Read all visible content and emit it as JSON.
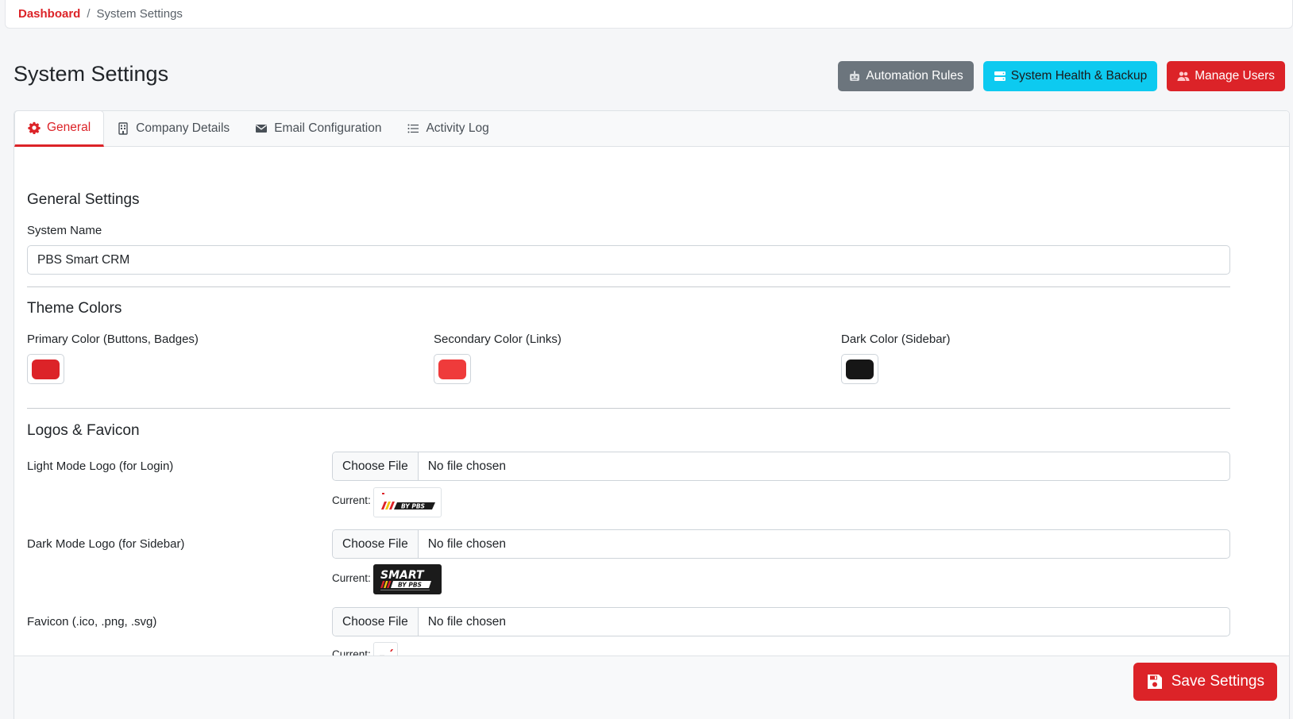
{
  "breadcrumb": {
    "home": "Dashboard",
    "separator": "/",
    "current": "System Settings"
  },
  "page": {
    "title": "System Settings"
  },
  "actions": {
    "automation": "Automation Rules",
    "health": "System Health & Backup",
    "users": "Manage Users"
  },
  "tabs": [
    {
      "label": "General",
      "icon": "gear-icon"
    },
    {
      "label": "Company Details",
      "icon": "building-icon"
    },
    {
      "label": "Email Configuration",
      "icon": "envelope-icon"
    },
    {
      "label": "Activity Log",
      "icon": "list-icon"
    }
  ],
  "general": {
    "section_title": "General Settings",
    "system_name_label": "System Name",
    "system_name_value": "PBS Smart CRM"
  },
  "theme": {
    "section_title": "Theme Colors",
    "primary_label": "Primary Color (Buttons, Badges)",
    "primary_color": "#dc2328",
    "secondary_label": "Secondary Color (Links)",
    "secondary_color": "#ef3b3b",
    "dark_label": "Dark Color (Sidebar)",
    "dark_color": "#161616"
  },
  "logos": {
    "section_title": "Logos & Favicon",
    "choose_file": "Choose File",
    "no_file": "No file chosen",
    "current_label": "Current:",
    "light_label": "Light Mode Logo (for Login)",
    "dark_label": "Dark Mode Logo (for Sidebar)",
    "favicon_label": "Favicon (.ico, .png, .svg)"
  },
  "footer": {
    "save": "Save Settings"
  },
  "colors": {
    "accent": "#dc2328",
    "info": "#0dcaf0",
    "secondary": "#6c757d"
  }
}
